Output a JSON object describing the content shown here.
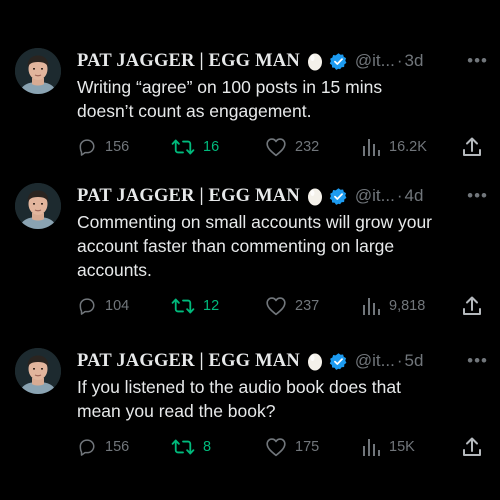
{
  "colors": {
    "background": "#000000",
    "text": "#e7e9ea",
    "muted": "#71767b",
    "verified": "#1d9bf0",
    "retweet": "#00ba7c"
  },
  "icons": [
    "reply-icon",
    "retweet-icon",
    "like-icon",
    "views-icon",
    "share-icon",
    "egg-icon",
    "verified-badge-icon",
    "more-icon"
  ],
  "tweets": [
    {
      "author": "PAT JAGGER | EGG MAN",
      "handle": "@it...",
      "separator": "·",
      "time": "3d",
      "more": "•••",
      "lines": [
        "Writing “agree” on 100 posts in 15 mins",
        "doesn’t count as engagement."
      ],
      "replies": "156",
      "retweets": "16",
      "likes": "232",
      "views": "16.2K"
    },
    {
      "author": "PAT JAGGER | EGG MAN",
      "handle": "@it...",
      "separator": "·",
      "time": "4d",
      "more": "•••",
      "lines": [
        "Commenting on small accounts will grow your",
        "account faster than commenting on large",
        "accounts."
      ],
      "replies": "104",
      "retweets": "12",
      "likes": "237",
      "views": "9,818"
    },
    {
      "author": "PAT JAGGER | EGG MAN",
      "handle": "@it...",
      "separator": "·",
      "time": "5d",
      "more": "•••",
      "lines": [
        "If you listened to the audio book does that",
        "mean you read the book?"
      ],
      "replies": "156",
      "retweets": "8",
      "likes": "175",
      "views": "15K"
    }
  ]
}
